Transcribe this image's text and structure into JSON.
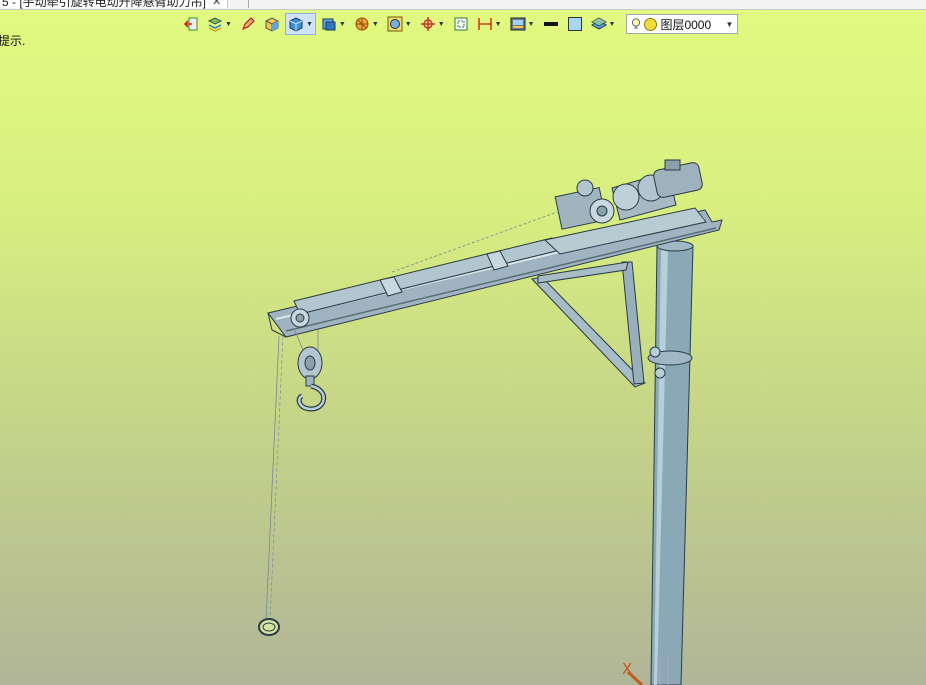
{
  "tab": {
    "title": "5 - [手动牵引旋转电动升降悬臂助力吊]",
    "close_glyph": "✕"
  },
  "hint_text": "提示.",
  "toolbar": {
    "buttons": [
      {
        "name": "exit-sketch-icon",
        "dropdown": false
      },
      {
        "name": "layers-stack-icon",
        "dropdown": true
      },
      {
        "name": "pencil-icon",
        "dropdown": false
      },
      {
        "name": "shaded-box-icon",
        "dropdown": false
      },
      {
        "name": "render-mode-icon",
        "dropdown": true,
        "active": true
      },
      {
        "name": "view-orient-icon",
        "dropdown": true
      },
      {
        "name": "section-view-icon",
        "dropdown": true
      },
      {
        "name": "display-filter-icon",
        "dropdown": true
      },
      {
        "name": "origin-triad-icon",
        "dropdown": true
      },
      {
        "name": "zoom-fit-icon",
        "dropdown": false
      },
      {
        "name": "dimension-icon",
        "dropdown": true
      },
      {
        "name": "view-manager-icon",
        "dropdown": true
      },
      {
        "name": "line-style-icon",
        "dropdown": false
      },
      {
        "name": "color-swatch-icon",
        "dropdown": false
      },
      {
        "name": "plane-icon",
        "dropdown": true
      }
    ],
    "layer": {
      "label": "图层0000"
    }
  },
  "axis": {
    "x_label": "X"
  },
  "colors": {
    "steel": "#8fa6b4",
    "pole": "#8aa8b6",
    "outline": "#2b3b45",
    "cable": "#7b8890"
  }
}
